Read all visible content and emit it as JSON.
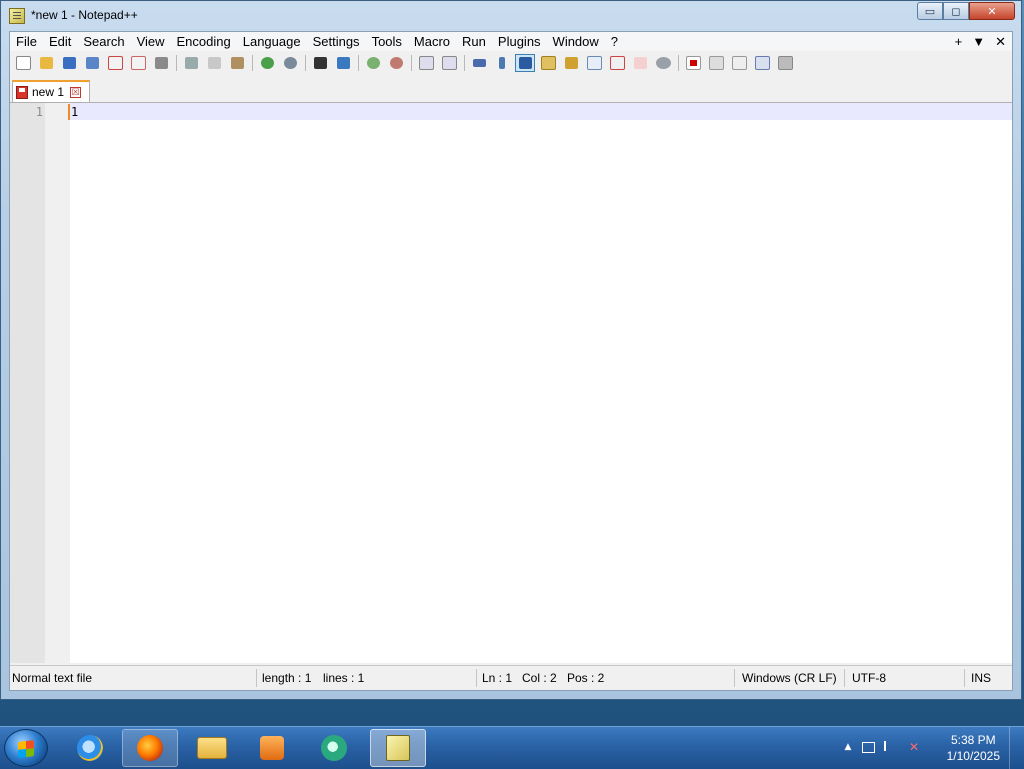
{
  "window": {
    "title": "*new 1 - Notepad++",
    "controls": {
      "minimize": "▭",
      "maximize": "◻",
      "close": "✕"
    }
  },
  "menu": {
    "items": [
      "File",
      "Edit",
      "Search",
      "View",
      "Encoding",
      "Language",
      "Settings",
      "Tools",
      "Macro",
      "Run",
      "Plugins",
      "Window",
      "?"
    ],
    "right": {
      "plus": "+",
      "dropdown": "▼",
      "close": "✕"
    }
  },
  "toolbar": {
    "icons": [
      "new-file-icon",
      "open-file-icon",
      "save-icon",
      "save-all-icon",
      "close-icon",
      "close-all-icon",
      "print-icon",
      "cut-icon",
      "copy-icon",
      "paste-icon",
      "undo-icon",
      "redo-icon",
      "find-icon",
      "replace-icon",
      "zoom-in-icon",
      "zoom-out-icon",
      "sync-vertical-icon",
      "sync-horizontal-icon",
      "word-wrap-icon",
      "show-all-chars-icon",
      "indent-guide-icon",
      "user-language-icon",
      "doc-map-icon",
      "function-list-icon",
      "folder-as-workspace-icon",
      "monitoring-icon",
      "comment-icon",
      "record-macro-icon",
      "stop-record-icon",
      "playback-icon",
      "run-macro-multiple-icon",
      "save-macro-icon"
    ]
  },
  "tabs": [
    {
      "label": "new 1",
      "close": "☒",
      "active": true
    }
  ],
  "editor": {
    "lines": [
      {
        "number": "1",
        "text": "1"
      }
    ]
  },
  "status": {
    "file_type": "Normal text file",
    "length": "length : 1",
    "lines": "lines : 1",
    "ln": "Ln : 1",
    "col": "Col : 2",
    "pos": "Pos : 2",
    "eol": "Windows (CR LF)",
    "encoding": "UTF-8",
    "mode": "INS"
  },
  "taskbar": {
    "apps": [
      "internet-explorer",
      "firefox",
      "file-explorer",
      "media-player",
      "chat-app",
      "notepad-plus-plus"
    ],
    "clock": {
      "time": "5:38 PM",
      "date": "1/10/2025"
    },
    "tray": {
      "show_hidden": "▲"
    }
  },
  "colors": {
    "accent_tab": "#f0a030",
    "current_line": "#e8e8ff",
    "caret": "#f08a24"
  }
}
